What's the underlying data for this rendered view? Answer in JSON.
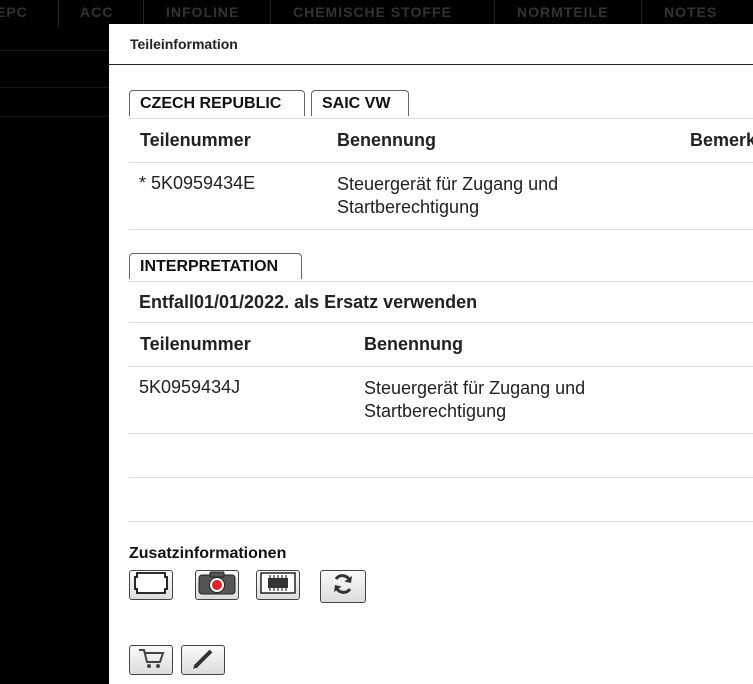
{
  "background_nav": [
    "EPC",
    "ACC",
    "INFOLINE",
    "CHEMISCHE STOFFE",
    "NORMTEILE",
    "NOTES"
  ],
  "dialog": {
    "title": "Teileinformation",
    "region_tabs": [
      "CZECH REPUBLIC",
      "SAIC VW"
    ],
    "parts_table": {
      "headers": [
        "Teilenummer",
        "Benennung",
        "Bemerkung"
      ],
      "rows": [
        {
          "part_number": "* 5K0959434E",
          "name_line1": "Steuergerät für Zugang und",
          "name_line2": "Startberechtigung"
        }
      ]
    },
    "interpretation_tab": "INTERPRETATION",
    "interpretation": {
      "note": "Entfall01/01/2022. als Ersatz verwenden",
      "headers": [
        "Teilenummer",
        "Benennung"
      ],
      "rows": [
        {
          "part_number": "5K0959434J",
          "name_line1": "Steuergerät für Zugang und",
          "name_line2": "Startberechtigung"
        }
      ]
    },
    "additional_info_label": "Zusatzinformationen",
    "icons": [
      "frame-icon",
      "camera-icon",
      "chip-icon",
      "refresh-icon",
      "cart-icon",
      "pencil-icon"
    ]
  },
  "colors": {
    "overlay": "#000000",
    "dialog_bg": "#ffffff",
    "tab_border": "#666666",
    "camera_red": "#e0202a"
  }
}
